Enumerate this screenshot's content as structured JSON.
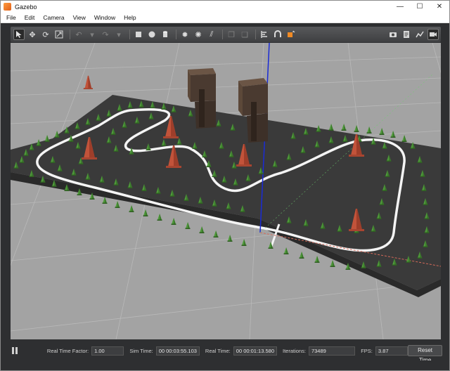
{
  "window": {
    "title": "Gazebo"
  },
  "window_controls": {
    "minimize": "—",
    "maximize": "☐",
    "close": "✕"
  },
  "menu": [
    "File",
    "Edit",
    "Camera",
    "View",
    "Window",
    "Help"
  ],
  "status": {
    "real_time_factor_label": "Real Time Factor:",
    "real_time_factor": "1.00",
    "sim_time_label": "Sim Time:",
    "sim_time": "00 00:03:55.103",
    "real_time_label": "Real Time:",
    "real_time": "00 00:01:13.580",
    "iterations_label": "Iterations:",
    "iterations": "73489",
    "fps_label": "FPS:",
    "fps": "3.87",
    "reset_label": "Reset Time"
  },
  "colors": {
    "accent_orange": "#f08a24",
    "ground": "#a3a3a3",
    "track_floor": "#3a3a3a",
    "cone_green": "#4f9a3a",
    "cone_red": "#c2533a",
    "axis_blue": "#1a2bd6"
  }
}
